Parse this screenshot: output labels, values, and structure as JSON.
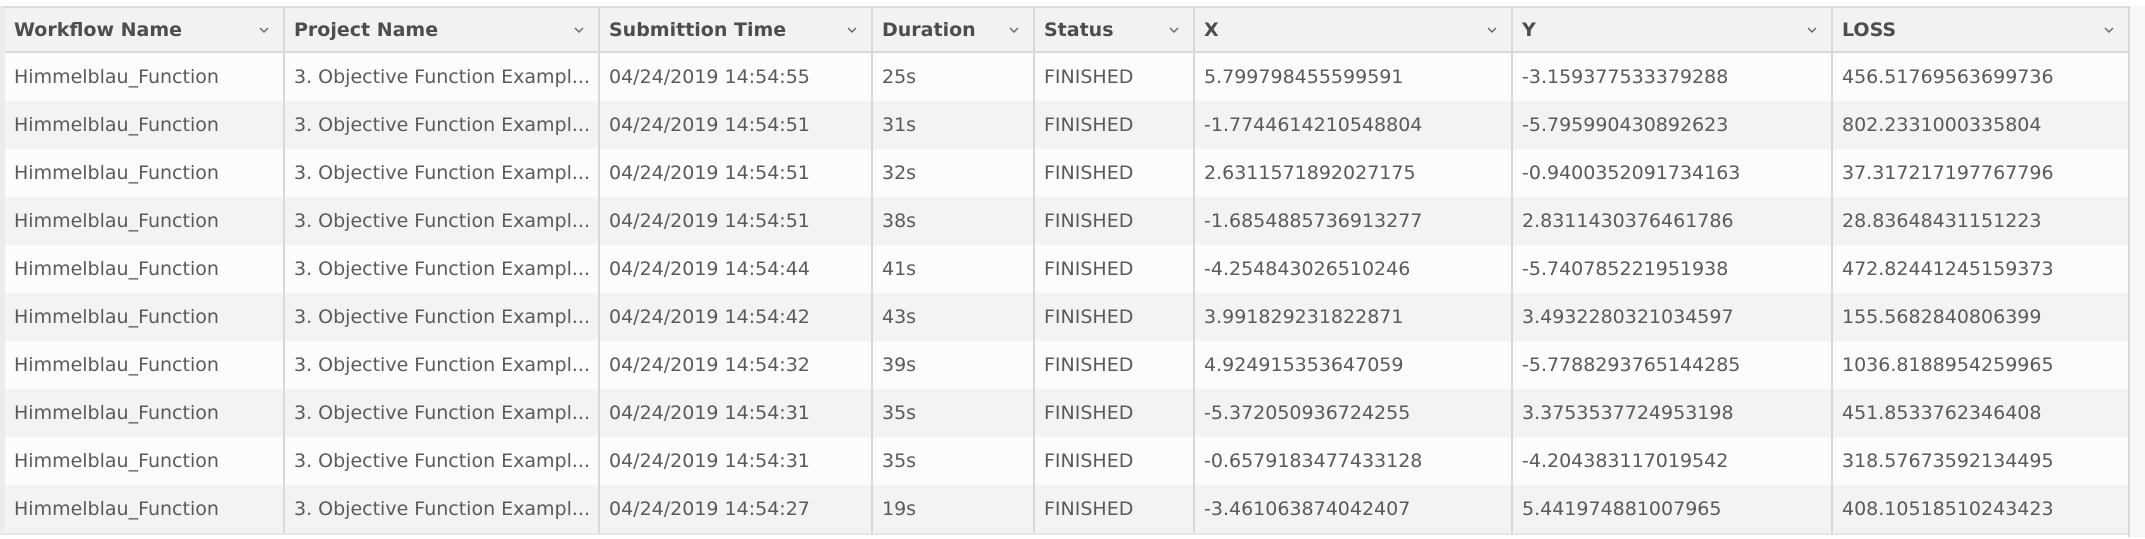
{
  "table": {
    "columns": [
      {
        "label": "Workflow Name",
        "icon": "chevron-down-icon"
      },
      {
        "label": "Project Name",
        "icon": "chevron-down-icon"
      },
      {
        "label": "Submittion Time",
        "icon": "chevron-down-icon"
      },
      {
        "label": "Duration",
        "icon": "chevron-down-icon"
      },
      {
        "label": "Status",
        "icon": "chevron-down-icon"
      },
      {
        "label": "X",
        "icon": "chevron-down-icon"
      },
      {
        "label": "Y",
        "icon": "chevron-down-icon"
      },
      {
        "label": "LOSS",
        "icon": "chevron-down-icon"
      }
    ],
    "rows": [
      {
        "workflow": "Himmelblau_Function",
        "project": "3. Objective Function Exampl...",
        "time": "04/24/2019 14:54:55",
        "duration": "25s",
        "status": "FINISHED",
        "x": "5.799798455599591",
        "y": "-3.159377533379288",
        "loss": "456.51769563699736"
      },
      {
        "workflow": "Himmelblau_Function",
        "project": "3. Objective Function Exampl...",
        "time": "04/24/2019 14:54:51",
        "duration": "31s",
        "status": "FINISHED",
        "x": "-1.7744614210548804",
        "y": "-5.795990430892623",
        "loss": "802.2331000335804"
      },
      {
        "workflow": "Himmelblau_Function",
        "project": "3. Objective Function Exampl...",
        "time": "04/24/2019 14:54:51",
        "duration": "32s",
        "status": "FINISHED",
        "x": "2.6311571892027175",
        "y": "-0.9400352091734163",
        "loss": "37.317217197767796"
      },
      {
        "workflow": "Himmelblau_Function",
        "project": "3. Objective Function Exampl...",
        "time": "04/24/2019 14:54:51",
        "duration": "38s",
        "status": "FINISHED",
        "x": "-1.6854885736913277",
        "y": "2.8311430376461786",
        "loss": "28.83648431151223"
      },
      {
        "workflow": "Himmelblau_Function",
        "project": "3. Objective Function Exampl...",
        "time": "04/24/2019 14:54:44",
        "duration": "41s",
        "status": "FINISHED",
        "x": "-4.254843026510246",
        "y": "-5.740785221951938",
        "loss": "472.82441245159373"
      },
      {
        "workflow": "Himmelblau_Function",
        "project": "3. Objective Function Exampl...",
        "time": "04/24/2019 14:54:42",
        "duration": "43s",
        "status": "FINISHED",
        "x": "3.991829231822871",
        "y": "3.4932280321034597",
        "loss": "155.5682840806399"
      },
      {
        "workflow": "Himmelblau_Function",
        "project": "3. Objective Function Exampl...",
        "time": "04/24/2019 14:54:32",
        "duration": "39s",
        "status": "FINISHED",
        "x": "4.924915353647059",
        "y": "-5.7788293765144285",
        "loss": "1036.8188954259965"
      },
      {
        "workflow": "Himmelblau_Function",
        "project": "3. Objective Function Exampl...",
        "time": "04/24/2019 14:54:31",
        "duration": "35s",
        "status": "FINISHED",
        "x": "-5.372050936724255",
        "y": "3.3753537724953198",
        "loss": "451.8533762346408"
      },
      {
        "workflow": "Himmelblau_Function",
        "project": "3. Objective Function Exampl...",
        "time": "04/24/2019 14:54:31",
        "duration": "35s",
        "status": "FINISHED",
        "x": "-0.6579183477433128",
        "y": "-4.204383117019542",
        "loss": "318.57673592134495"
      },
      {
        "workflow": "Himmelblau_Function",
        "project": "3. Objective Function Exampl...",
        "time": "04/24/2019 14:54:27",
        "duration": "19s",
        "status": "FINISHED",
        "x": "-3.461063874042407",
        "y": "5.441974881007965",
        "loss": "408.10518510243423"
      }
    ]
  }
}
